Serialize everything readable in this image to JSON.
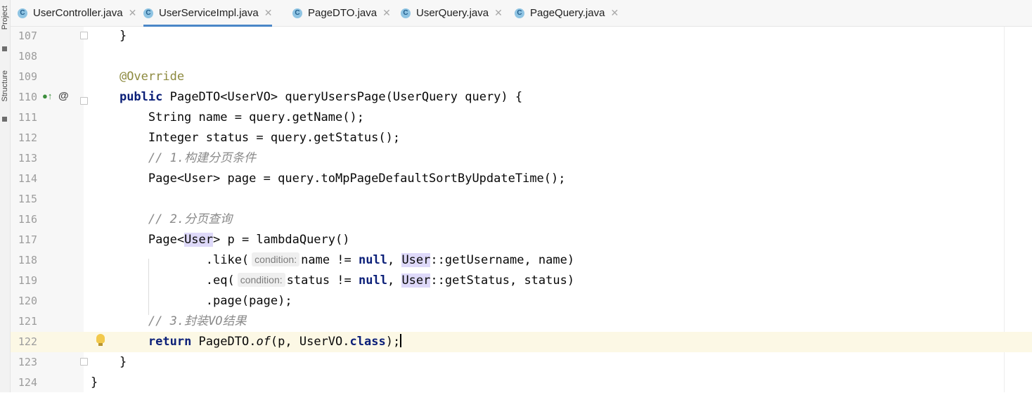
{
  "sidebar": {
    "project_label": "Project",
    "structure_label": "Structure"
  },
  "tabs": [
    {
      "icon": "C",
      "label": "UserController.java",
      "close": "✕"
    },
    {
      "icon": "C",
      "label": "UserServiceImpl.java",
      "close": "✕"
    },
    {
      "icon": "C",
      "label": "PageDTO.java",
      "close": "✕"
    },
    {
      "icon": "C",
      "label": "UserQuery.java",
      "close": "✕"
    },
    {
      "icon": "C",
      "label": "PageQuery.java",
      "close": "✕"
    }
  ],
  "active_tab_index": 1,
  "editor": {
    "lines": [
      {
        "num": "107",
        "tokens": [
          {
            "t": "    }"
          }
        ]
      },
      {
        "num": "108",
        "tokens": []
      },
      {
        "num": "109",
        "tokens": [
          {
            "t": "    "
          },
          {
            "t": "@Override",
            "c": "ann"
          }
        ]
      },
      {
        "num": "110",
        "tokens": [
          {
            "t": "    "
          },
          {
            "t": "public",
            "c": "kw"
          },
          {
            "t": " PageDTO<UserVO> queryUsersPage(UserQuery query) {"
          }
        ]
      },
      {
        "num": "111",
        "tokens": [
          {
            "t": "        String name = query.getName();"
          }
        ]
      },
      {
        "num": "112",
        "tokens": [
          {
            "t": "        Integer status = query.getStatus();"
          }
        ]
      },
      {
        "num": "113",
        "tokens": [
          {
            "t": "        "
          },
          {
            "t": "// 1.构建分页条件",
            "c": "cm"
          }
        ]
      },
      {
        "num": "114",
        "tokens": [
          {
            "t": "        Page<User> page = query.toMpPageDefaultSortByUpdateTime();"
          }
        ]
      },
      {
        "num": "115",
        "tokens": []
      },
      {
        "num": "116",
        "tokens": [
          {
            "t": "        "
          },
          {
            "t": "// 2.分页查询",
            "c": "cm"
          }
        ]
      },
      {
        "num": "117",
        "tokens": [
          {
            "t": "        Page<"
          },
          {
            "t": "User",
            "c": "hl"
          },
          {
            "t": "> p = lambdaQuery()"
          }
        ]
      },
      {
        "num": "118",
        "tokens": [
          {
            "t": "                .like("
          },
          {
            "t": "condition:",
            "c": "hint"
          },
          {
            "t": "name != "
          },
          {
            "t": "null",
            "c": "kw"
          },
          {
            "t": ", "
          },
          {
            "t": "User",
            "c": "hl"
          },
          {
            "t": "::getUsername, name)"
          }
        ]
      },
      {
        "num": "119",
        "tokens": [
          {
            "t": "                .eq("
          },
          {
            "t": "condition:",
            "c": "hint"
          },
          {
            "t": "status != "
          },
          {
            "t": "null",
            "c": "kw"
          },
          {
            "t": ", "
          },
          {
            "t": "User",
            "c": "hl"
          },
          {
            "t": "::getStatus, status)"
          }
        ]
      },
      {
        "num": "120",
        "tokens": [
          {
            "t": "                .page(page);"
          }
        ]
      },
      {
        "num": "121",
        "tokens": [
          {
            "t": "        "
          },
          {
            "t": "// 3.封装VO结果",
            "c": "cm"
          }
        ]
      },
      {
        "num": "122",
        "tokens": [
          {
            "t": "        "
          },
          {
            "t": "return",
            "c": "kw"
          },
          {
            "t": " PageDTO."
          },
          {
            "t": "of",
            "c": "it"
          },
          {
            "t": "(p, UserVO."
          },
          {
            "t": "class",
            "c": "kw"
          },
          {
            "t": ");"
          }
        ]
      },
      {
        "num": "123",
        "tokens": [
          {
            "t": "    }"
          }
        ]
      },
      {
        "num": "124",
        "tokens": [
          {
            "t": "}"
          }
        ]
      }
    ]
  },
  "icons": {
    "tab_file": "java-class-icon",
    "gutter_110_a": "implementation-marker-icon",
    "gutter_110_b": "override-marker-icon",
    "gutter_122": "lightbulb-icon",
    "fold": "fold-marker-icon"
  },
  "colors": {
    "keyword": "#0b1f78",
    "annotation": "#8d8a3f",
    "comment": "#8a8a8a",
    "highlight": "#ded9f9",
    "current_line": "#fcf8e5",
    "active_tab_underline": "#4a86c7"
  }
}
